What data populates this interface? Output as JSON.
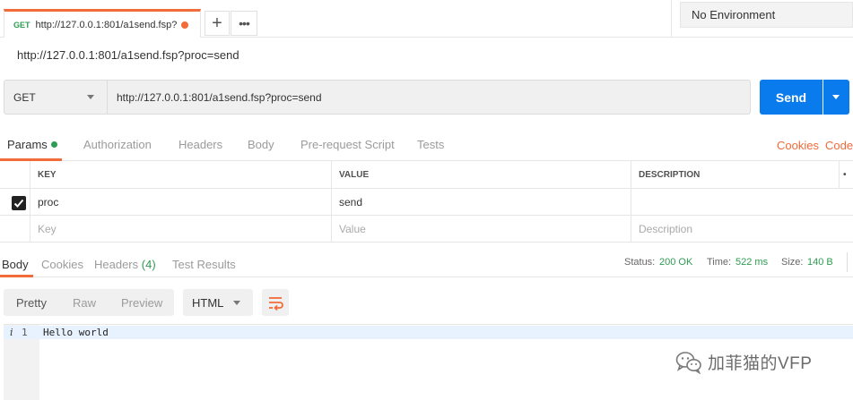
{
  "tab": {
    "method": "GET",
    "title": "http://127.0.0.1:801/a1send.fsp?",
    "add_label": "+",
    "more_label": "•••"
  },
  "environment": {
    "selected": "No Environment"
  },
  "request": {
    "title": "http://127.0.0.1:801/a1send.fsp?proc=send",
    "method": "GET",
    "url": "http://127.0.0.1:801/a1send.fsp?proc=send",
    "send_label": "Send"
  },
  "request_tabs": {
    "items": [
      "Params",
      "Authorization",
      "Headers",
      "Body",
      "Pre-request Script",
      "Tests"
    ],
    "cookies": "Cookies",
    "code": "Code",
    "active_index": 0
  },
  "params": {
    "headers": [
      "KEY",
      "VALUE",
      "DESCRIPTION"
    ],
    "bulk_glyph": "•",
    "rows": [
      {
        "checked": true,
        "key": "proc",
        "value": "send",
        "description": ""
      }
    ],
    "placeholder": {
      "key": "Key",
      "value": "Value",
      "description": "Description"
    }
  },
  "response_tabs": {
    "items": [
      "Body",
      "Cookies",
      "Headers",
      "Test Results"
    ],
    "headers_count": "(4)",
    "active_index": 0
  },
  "status": {
    "status_label": "Status:",
    "status_value": "200 OK",
    "time_label": "Time:",
    "time_value": "522 ms",
    "size_label": "Size:",
    "size_value": "140 B"
  },
  "format": {
    "modes": [
      "Pretty",
      "Raw",
      "Preview"
    ],
    "active_mode": "Pretty",
    "language": "HTML"
  },
  "response_body": {
    "line_number": "1",
    "info_glyph": "i",
    "text": "Hello world"
  },
  "watermark": {
    "text": "加菲猫的VFP"
  },
  "colors": {
    "accent": "#f26b3a",
    "send_blue": "#097bed",
    "success_green": "#2e9c52"
  }
}
